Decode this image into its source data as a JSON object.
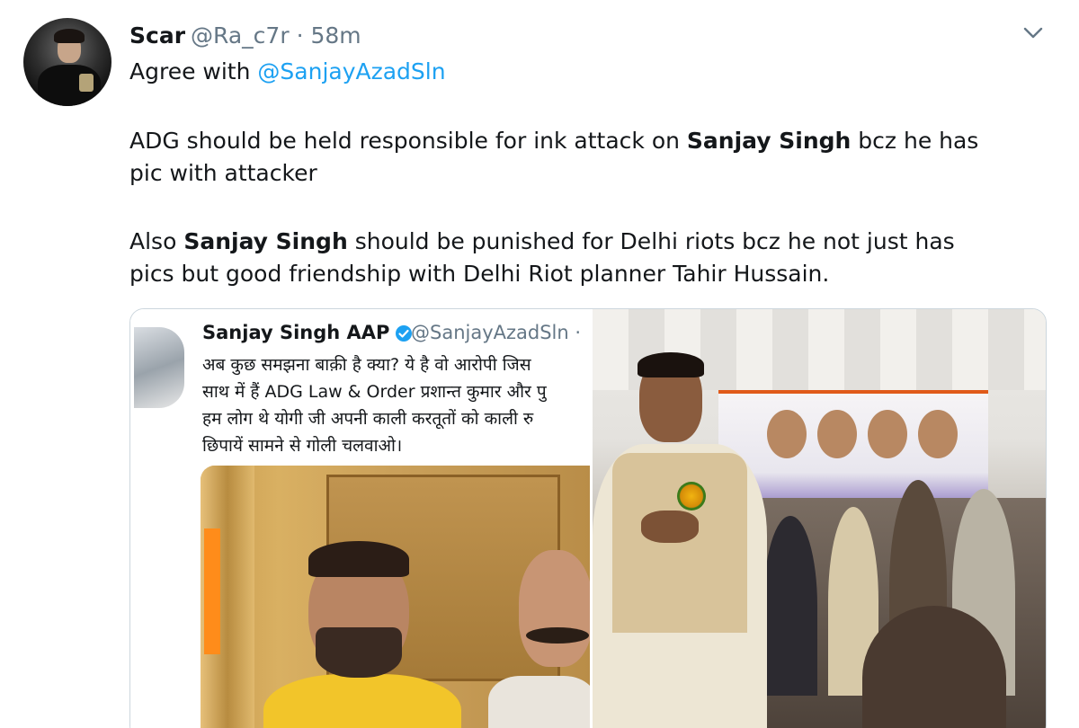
{
  "tweet": {
    "author_name": "Scar",
    "author_handle": "@Ra_c7r",
    "separator": "·",
    "time": "58m",
    "line1_prefix": "Agree with ",
    "line1_mention": "@SanjayAzadSln",
    "line2_part1": "ADG should be held responsible for ink attack on ",
    "line2_bold": "Sanjay Singh",
    "line2_part2": " bcz he has",
    "line3": "pic with attacker",
    "line4_part1": "Also ",
    "line4_bold": "Sanjay Singh",
    "line4_part2": " should be punished for Delhi riots bcz he not just has",
    "line5": "pics but good friendship with Delhi Riot planner Tahir Hussain."
  },
  "embedded": {
    "name": "Sanjay Singh AAP",
    "handle": "@SanjayAzadSln ·",
    "line1": "अब कुछ समझना बाक़ी है क्या? ये है वो आरोपी जिस",
    "line2": "साथ में हैं ADG Law & Order प्रशान्त कुमार और पु",
    "line3": "हम लोग थे योगी जी अपनी काली करतूतों को काली रु",
    "line4": "छिपायें सामने से गोली चलवाओ।"
  },
  "icons": {
    "menu": "chevron-down-icon",
    "verified": "verified-badge-icon"
  },
  "colors": {
    "text": "#14171a",
    "muted": "#657786",
    "mention": "#1da1f2",
    "border": "#ccd6dd"
  }
}
